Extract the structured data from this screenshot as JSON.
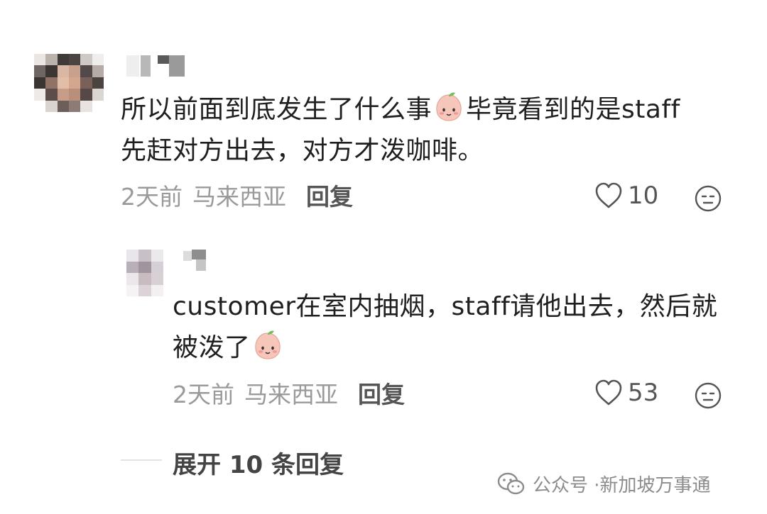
{
  "comments": [
    {
      "text_before_emoji": "所以前面到底发生了什么事",
      "emoji": "peach-face",
      "text_after_emoji": "毕竟看到的是staff 先赶对方出去，对方才泼咖啡。",
      "time": "2天前",
      "location": "马来西亚",
      "reply_label": "回复",
      "likes": "10"
    },
    {
      "text_before_emoji": "customer在室内抽烟，staff请他出去，然后就被泼了",
      "emoji": "peach-face",
      "text_after_emoji": "",
      "time": "2天前",
      "location": "马来西亚",
      "reply_label": "回复",
      "likes": "53"
    }
  ],
  "expand_replies_label": "展开 10 条回复",
  "watermark": {
    "prefix": "公众号 · ",
    "account": "新加坡万事通"
  },
  "icons": {
    "like": "heart-outline-icon",
    "dislike": "sad-face-icon",
    "watermark": "wechat-icon"
  },
  "colors": {
    "meta_text": "#9a9a9a",
    "reply_text": "#555555",
    "peach": "#f7c6ba"
  }
}
